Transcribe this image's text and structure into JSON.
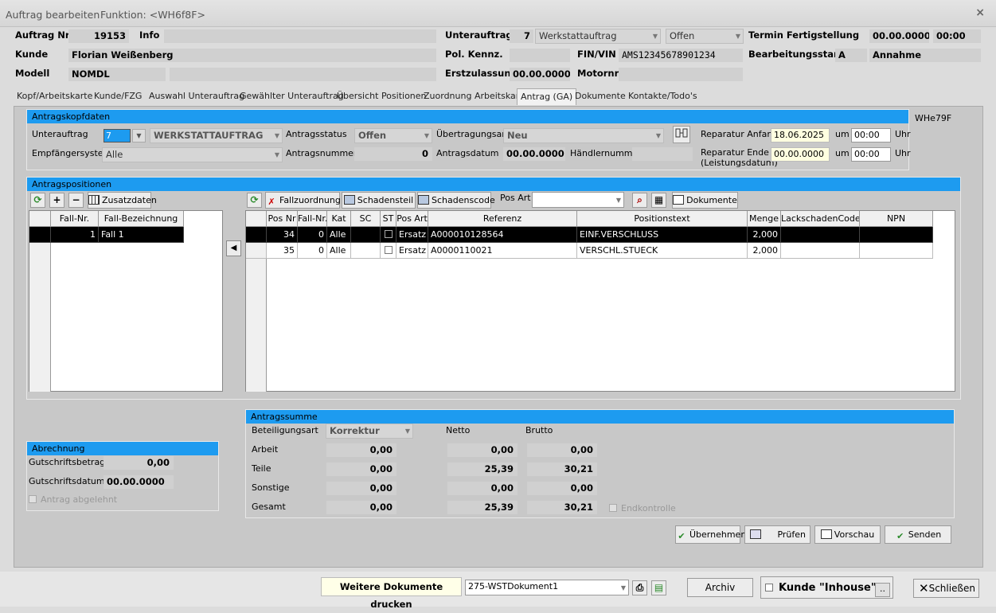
{
  "window": {
    "title": "Auftrag bearbeiten",
    "function": "Funktion: <WH6f8F>",
    "close": "×"
  },
  "header": {
    "auftrag_nr_label": "Auftrag Nr",
    "auftrag_nr": "19153",
    "info_label": "Info",
    "info": "",
    "kunde_label": "Kunde",
    "kunde": "Florian Weißenberg",
    "modell_label": "Modell",
    "modell": "NOMDL",
    "modell2": "",
    "unterauftrag_label": "Unterauftrag",
    "unterauftrag_nr": "7",
    "unterauftrag_art": "Werkstattauftrag",
    "unterauftrag_status": "Offen",
    "pol_kennz_label": "Pol. Kennz.",
    "pol_kennz": "",
    "fin_label": "FIN/VIN",
    "fin": "AMS12345678901234",
    "erstzulassung_label": "Erstzulassung",
    "erstzulassung": "00.00.0000",
    "motornr_label": "Motornr",
    "motornr": "",
    "termin_label": "Termin Fertigstellung",
    "termin_datum": "00.00.0000",
    "termin_zeit": "00:00",
    "bearbeitungsstand_label": "Bearbeitungsstand",
    "bearbeitungsstand": "A",
    "annahme": "Annahme"
  },
  "tabs": [
    "Kopf/Arbeitskarte",
    "Kunde/FZG",
    "Auswahl Unterauftrag",
    "Gewählter Unterauftrag",
    "Übersicht Positionen",
    "Zuordnung Arbeitskarte",
    "Antrag (GA)",
    "Dokumente",
    "Kontakte/Todo's"
  ],
  "kopf": {
    "title": "Antragskopfdaten",
    "code": "WHe79F",
    "unterauftrag_label": "Unterauftrag",
    "unterauftrag": "7",
    "unterauftrag_text": "WERKSTATTAUFTRAG",
    "empfaenger_label": "Empfängersystem",
    "empfaenger": "Alle",
    "status_label": "Antragsstatus",
    "status": "Offen",
    "nummer_label": "Antragsnummer",
    "nummer": "0",
    "uebertragung_label": "Übertragungsart",
    "uebertragung": "Neu",
    "datum_label": "Antragsdatum",
    "datum": "00.00.0000",
    "haendler_label": "Händlernummer",
    "haendler": "",
    "rep_anfang_label": "Reparatur Anfang",
    "rep_anfang": "18.06.2025",
    "rep_anfang_zeit": "00:00",
    "rep_ende_label": "Reparatur Ende",
    "rep_ende_sub": "(Leistungsdatum)",
    "rep_ende": "00.00.0000",
    "rep_ende_zeit": "00:00",
    "um": "um",
    "uhr": "Uhr"
  },
  "positionen": {
    "title": "Antragspositionen",
    "zusatzdaten": "Zusatzdaten",
    "fall_headers": [
      "Fall-Nr.",
      "Fall-Bezeichnung"
    ],
    "faelle": [
      {
        "nr": "1",
        "bez": "Fall 1"
      }
    ],
    "toolbar": {
      "fallzuordnung": "Fallzuordnung",
      "schadensteil": "Schadensteil",
      "schadenscode": "Schadenscode",
      "posart_label": "Pos Art",
      "posart": "",
      "dokumente": "Dokumente"
    },
    "headers": [
      "Pos Nr",
      "Fall-Nr.",
      "Kat",
      "SC",
      "ST",
      "Pos Art",
      "Referenz",
      "Positionstext",
      "Menge",
      "LackschadenCode",
      "NPN"
    ],
    "rows": [
      {
        "pos": "34",
        "fall": "0",
        "kat": "Alle",
        "sc": "",
        "art": "Ersatz",
        "ref": "A000010128564",
        "text": "EINF.VERSCHLUSS",
        "menge": "2,000",
        "lack": "",
        "npn": ""
      },
      {
        "pos": "35",
        "fall": "0",
        "kat": "Alle",
        "sc": "",
        "art": "Ersatz",
        "ref": "A0000110021",
        "text": "VERSCHL.STUECK",
        "menge": "2,000",
        "lack": "",
        "npn": ""
      }
    ]
  },
  "abrechnung": {
    "title": "Abrechnung",
    "gutschrift_label": "Gutschriftsbetrag",
    "gutschrift": "0,00",
    "gdatum_label": "Gutschriftsdatum",
    "gdatum": "00.00.0000",
    "abgelehnt": "Antrag abgelehnt"
  },
  "summe": {
    "title": "Antragssumme",
    "beteiligung_label": "Beteiligungsart",
    "beteiligung": "Korrektur",
    "netto": "Netto",
    "brutto": "Brutto",
    "rows": [
      {
        "label": "Arbeit",
        "betrag": "0,00",
        "netto": "0,00",
        "brutto": "0,00"
      },
      {
        "label": "Teile",
        "betrag": "0,00",
        "netto": "25,39",
        "brutto": "30,21"
      },
      {
        "label": "Sonstige",
        "betrag": "0,00",
        "netto": "0,00",
        "brutto": "0,00"
      },
      {
        "label": "Gesamt",
        "betrag": "0,00",
        "netto": "25,39",
        "brutto": "30,21"
      }
    ],
    "endkontrolle": "Endkontrolle"
  },
  "actions": {
    "uebernehmen": "Übernehmen",
    "pruefen": "Prüfen",
    "vorschau": "Vorschau",
    "senden": "Senden"
  },
  "footer": {
    "weitere": "Weitere Dokumente drucken",
    "dokument": "275-WSTDokument1",
    "archiv": "Archiv",
    "inhouse": "Kunde \"Inhouse\"",
    "dots": "..",
    "schliessen": "Schließen"
  }
}
